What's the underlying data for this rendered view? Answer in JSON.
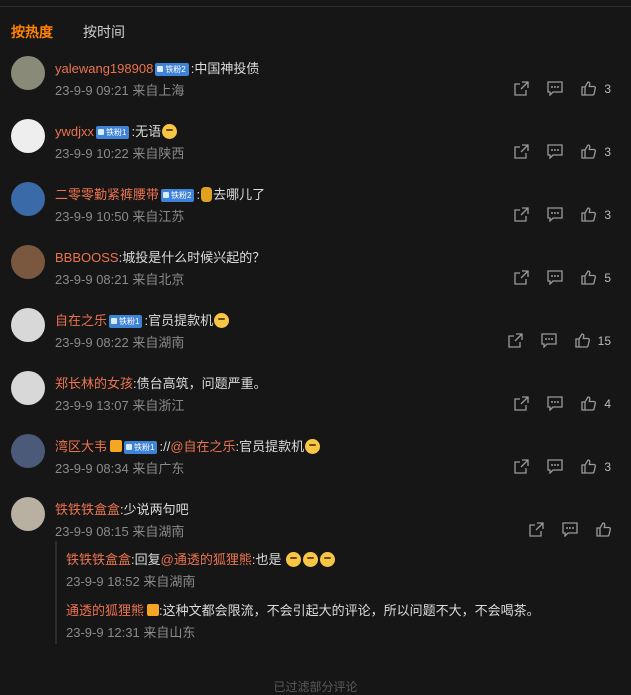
{
  "tabs": [
    "按热度",
    "按时间"
  ],
  "comments": [
    {
      "user": "yalewang198908",
      "badge": "铁粉2",
      "text": ":中国神投债",
      "time": "23-9-9 09:21 来自上海",
      "likes": "3",
      "avatar": "#8a8a78"
    },
    {
      "user": "ywdjxx",
      "badge": "铁粉1",
      "text": ":无语",
      "time": "23-9-9 10:22 来自陕西",
      "likes": "3",
      "avatar": "#eeeeee"
    },
    {
      "user": "二零零勤紧裤腰带",
      "badge": "铁粉2",
      "text": ":",
      "text2": "去哪儿了",
      "time": "23-9-9 10:50 来自江苏",
      "likes": "3",
      "avatar": "#3a6aa8"
    },
    {
      "user": "BBBOOSS",
      "text": ":城投是什么时候兴起的？",
      "time": "23-9-9 08:21 来自北京",
      "likes": "5",
      "avatar": "#7a5840"
    },
    {
      "user": "自在之乐",
      "badge": "铁粉1",
      "text": ":官员提款机",
      "time": "23-9-9 08:22 来自湖南",
      "likes": "15",
      "avatar": "#d8d8d8"
    },
    {
      "user": "郑长林的女孩",
      "text": ":债台高筑，问题严重。",
      "time": "23-9-9 13:07 来自浙江",
      "likes": "4",
      "avatar": "#d8d8d8"
    },
    {
      "user": "湾区大韦",
      "badge": "铁粉1",
      "text": "://",
      "mention": "@自在之乐",
      "text2": ":官员提款机",
      "time": "23-9-9 08:34 来自广东",
      "likes": "3",
      "avatar": "#4a5a78"
    },
    {
      "user": "铁铁铁盒盒",
      "text": ":少说两句吧",
      "time": "23-9-9 08:15 来自湖南",
      "likes": "",
      "avatar": "#b8b0a0"
    }
  ],
  "replies": [
    {
      "user": "铁铁铁盒盒",
      "prefix": ":回复",
      "mention": "@通透的狐狸熊",
      "text": ":也是",
      "time": "23-9-9 18:52 来自湖南"
    },
    {
      "user": "通透的狐狸熊",
      "text": ":这种文都会限流，不会引起大的评论，所以问题不大，不会喝茶。",
      "time": "23-9-9 12:31 来自山东"
    }
  ],
  "footer": "已过滤部分评论"
}
